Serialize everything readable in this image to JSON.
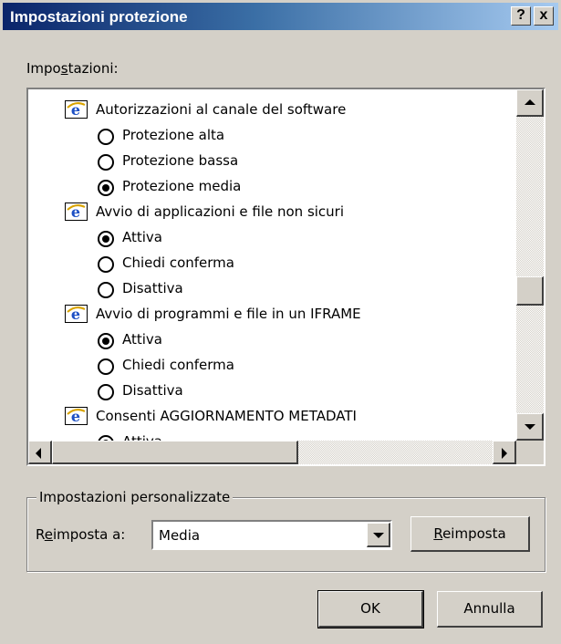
{
  "window": {
    "title": "Impostazioni protezione",
    "help_label": "?",
    "close_label": "x"
  },
  "settings_label_pre": "Impo",
  "settings_label_key": "s",
  "settings_label_post": "tazioni:",
  "settings": [
    {
      "kind": "category",
      "label": "Autorizzazioni al canale del software"
    },
    {
      "kind": "option",
      "label": "Protezione alta",
      "selected": false
    },
    {
      "kind": "option",
      "label": "Protezione bassa",
      "selected": false
    },
    {
      "kind": "option",
      "label": "Protezione media",
      "selected": true
    },
    {
      "kind": "category",
      "label": "Avvio di applicazioni e file non sicuri"
    },
    {
      "kind": "option",
      "label": "Attiva",
      "selected": true
    },
    {
      "kind": "option",
      "label": "Chiedi conferma",
      "selected": false
    },
    {
      "kind": "option",
      "label": "Disattiva",
      "selected": false
    },
    {
      "kind": "category",
      "label": "Avvio di programmi e file in un IFRAME"
    },
    {
      "kind": "option",
      "label": "Attiva",
      "selected": true
    },
    {
      "kind": "option",
      "label": "Chiedi conferma",
      "selected": false
    },
    {
      "kind": "option",
      "label": "Disattiva",
      "selected": false
    },
    {
      "kind": "category",
      "label": "Consenti AGGIORNAMENTO METADATI"
    },
    {
      "kind": "option",
      "label": "Attiva",
      "selected": true
    }
  ],
  "custom": {
    "group_label": "Impostazioni personalizzate",
    "reset_to_pre": "R",
    "reset_to_key": "e",
    "reset_to_post": "imposta a:",
    "level_value": "Media",
    "reset_button_key": "R",
    "reset_button_post": "eimposta"
  },
  "buttons": {
    "ok": "OK",
    "cancel": "Annulla"
  },
  "colors": {
    "titlebar_start": "#0a246a",
    "titlebar_end": "#a6caf0",
    "face": "#d4d0c8",
    "ie_blue": "#1c4fc4"
  }
}
